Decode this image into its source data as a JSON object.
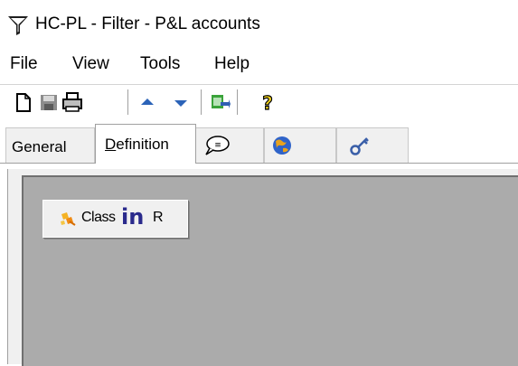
{
  "window": {
    "title": "HC-PL - Filter - P&L accounts",
    "icon": "filter-funnel-icon"
  },
  "menu": {
    "items": [
      {
        "label": "File"
      },
      {
        "label": "View"
      },
      {
        "label": "Tools"
      },
      {
        "label": "Help"
      }
    ]
  },
  "toolbar": {
    "buttons": [
      {
        "icon": "new-document-icon"
      },
      {
        "icon": "save-icon"
      },
      {
        "icon": "print-icon"
      },
      {
        "icon": "move-up-icon"
      },
      {
        "icon": "move-down-icon"
      },
      {
        "icon": "export-icon"
      },
      {
        "icon": "help-icon"
      }
    ]
  },
  "tabs": [
    {
      "label": "General",
      "active": false
    },
    {
      "label": "Definition",
      "active": true
    },
    {
      "label": "",
      "icon": "comment-icon"
    },
    {
      "label": "",
      "icon": "globe-icon"
    },
    {
      "label": "",
      "icon": "key-icon"
    }
  ],
  "definition": {
    "class_button": {
      "icon": "class-hierarchy-icon",
      "word": "Class",
      "operator": "in",
      "value": "R"
    }
  },
  "colors": {
    "panel_background": "#ababab",
    "client_background": "#f0f0f0",
    "operator_color": "#2a2a8c"
  }
}
